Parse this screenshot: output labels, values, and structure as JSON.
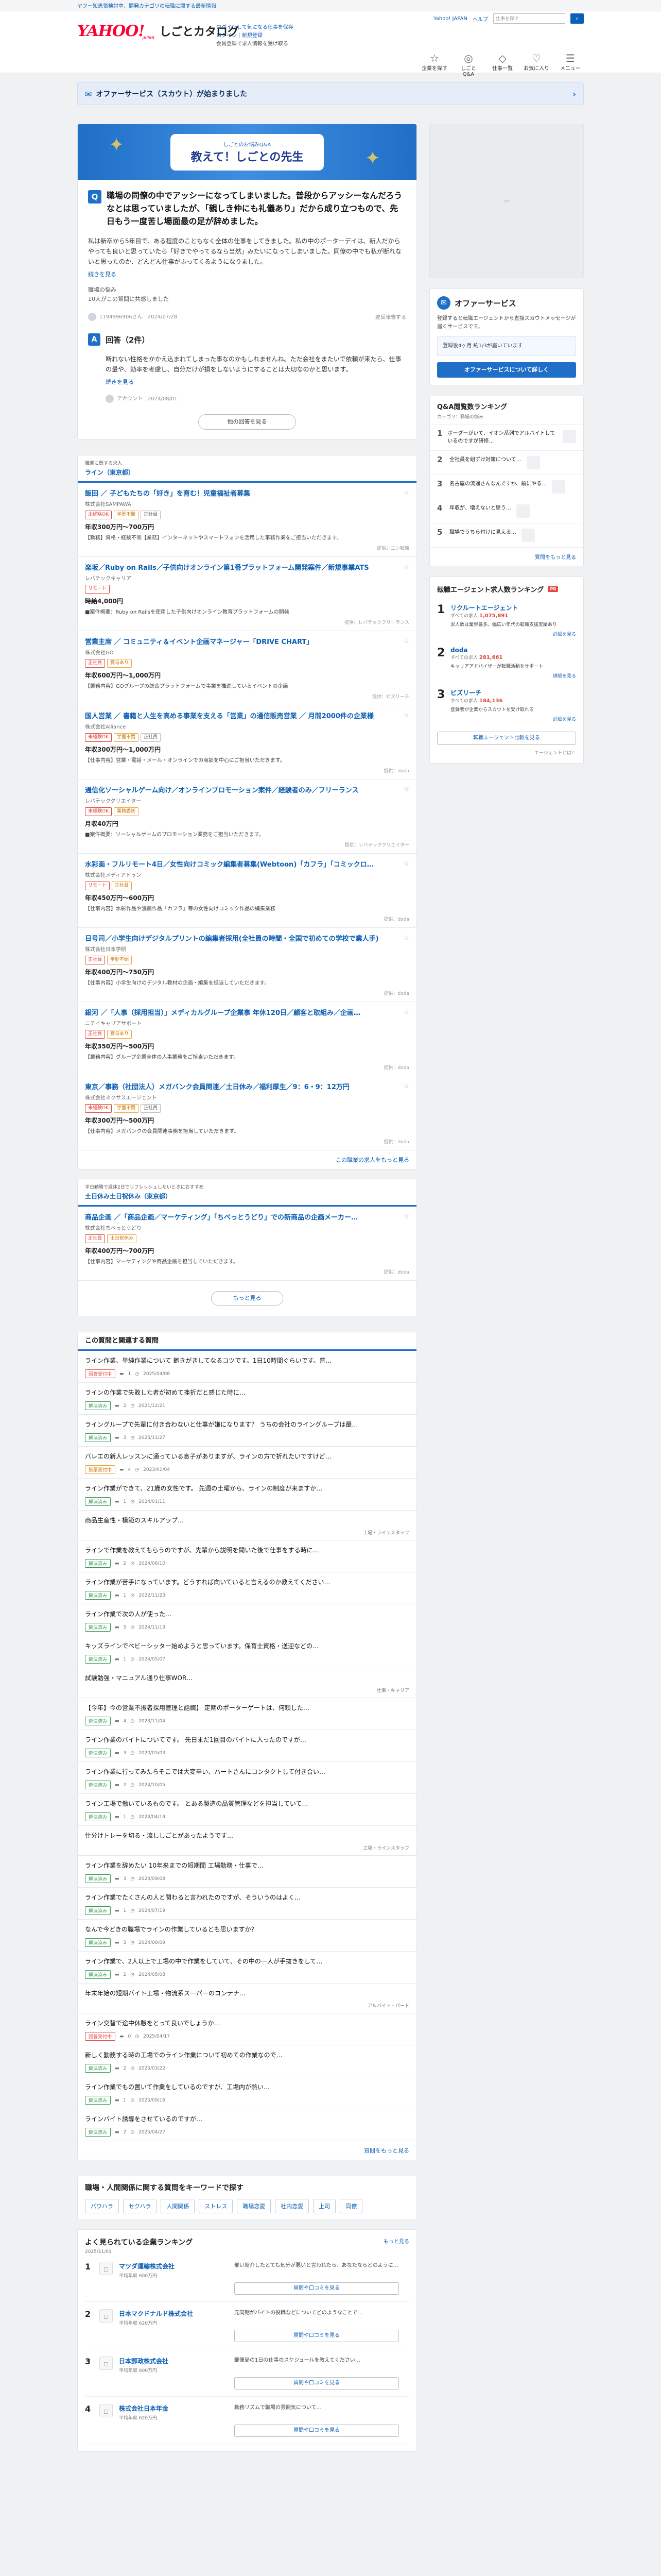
{
  "topstrip": "ヤフー知恵袋検討中、開発カテゴリの転職に関する最新情報",
  "header": {
    "logo_y": "YAHOO!",
    "logo_jp": "JAPAN",
    "title": "しごとカタログ",
    "link1": "ログインして気になる仕事を保存",
    "link2": "ログイン｜新規登録",
    "link3": "会員登録で求人情報を受け取る",
    "tr_yahoo": "Yahoo! JAPAN",
    "tr_help": "ヘルプ",
    "search_ph": "仕事を探す",
    "nav": [
      {
        "icon": "☆",
        "label": "企業を探す"
      },
      {
        "icon": "◎",
        "label": "しごとQ&A"
      },
      {
        "icon": "◇",
        "label": "仕事一覧"
      },
      {
        "icon": "♡",
        "label": "お気に入り"
      },
      {
        "icon": "☰",
        "label": "メニュー"
      }
    ]
  },
  "banner": {
    "text": "オファーサービス（スカウト）が始まりました"
  },
  "question": {
    "hero_small": "しごとのお悩みQ&A",
    "hero_big": "教えて！しごとの先生",
    "mark": "Q",
    "title": "職場の同僚の中でアッシーになってしまいました。普段からアッシーなんだろうなとは思っていましたが、「親しき仲にも礼儀あり」だから成り立つもので、先日もう一度苦し場面最の足が辞めました。",
    "body": "私は新卒から5年目で、ある程度のこともなく全体の仕事をしてきました。私の中のポーターデイは、新人だからやっても良いと思っていたら「好きでやってるなら当然」みたいになってしまいました。同僚の中でも私が断れないと思ったのか、どんどん仕事がふってくるようになりました。",
    "more": "続きを見る",
    "tag_head": "職場の悩み",
    "tags": "10人がこの質問に共感しました",
    "user": "1194996906さん",
    "date": "2024/07/28",
    "report": "違反報告する"
  },
  "answers": {
    "mark": "A",
    "head": "回答（2件）",
    "body": "断れない性格をかかえ込まれてしまった事なのかもしれませんね。ただ会社をまたいで依頼が来たら、仕事の量や、効率を考慮し、自分だけが損をしないようにすることは大切なのかと思います。",
    "more": "続きを見る",
    "user": "アカウント",
    "date": "2024/08/01",
    "all": "他の回答を見る"
  },
  "jobs": {
    "pre": "職業に関する求人",
    "title": "ライン（東京都）",
    "list": [
      {
        "title": "飯田 ／ 子どもたちの「好き」を育む！児童福祉者募集",
        "company": "株式会社SAMPAWA",
        "badges": [
          "未経験OK",
          "学歴不問",
          "正社員"
        ],
        "salary": "年収300万円〜700万円",
        "desc": "【勤務】資格・経験不問【業務】インターネットやスマートフォンを活用した事務作業をご担当いただきます。",
        "src": "提供：エン転職"
      },
      {
        "title": "楽坂／Ruby on Rails／子供向けオンライン第1番プラットフォーム開発案件／新規事業ATS",
        "company": "レバテックキャリア",
        "badges": [
          "リモート"
        ],
        "salary": "時給4,000円",
        "desc": "■案件概要：Ruby on Railsを使用した子供向けオンライン教育プラットフォームの開発",
        "src": "提供：レバテックフリーランス"
      },
      {
        "title": "営業主席 ／ コミュニティ＆イベント企画マネージャー「DRIVE CHART」",
        "company": "株式会社GO",
        "badges": [
          "正社員",
          "賞与あり"
        ],
        "salary": "年収600万円〜1,000万円",
        "desc": "【業務内容】GOグループの総合プラットフォームで事業を推進しているイベントの企画",
        "src": "提供：ビズリーチ"
      },
      {
        "title": "国人営業 ／ 書籍と人生を高める事業を支える「営業」の通信販売営業 ／ 月間2000件の企業様",
        "company": "株式会社Alliance",
        "badges": [
          "未経験OK",
          "学歴不問",
          "正社員"
        ],
        "salary": "年収300万円〜1,000万円",
        "desc": "【仕事内容】営業・電話・メール・オンラインでの商談を中心にご担当いただきます。",
        "src": "提供：doda"
      },
      {
        "title": "通信化ソーシャルゲーム向け／オンラインプロモーション案件／経験者のみ／フリーランス",
        "company": "レバテッククリエイター",
        "badges": [
          "未経験OK",
          "業務委託"
        ],
        "salary": "月収40万円",
        "desc": "■案件概要：ソーシャルゲームのプロモーション業務をご担当いただきます。",
        "src": "提供：レバテッククリエイター"
      },
      {
        "title": "水彩画・フルリモート4日／女性向けコミック編集者募集(Webtoon)「カフラ」「コミックロ…",
        "company": "株式会社メディアトゥン",
        "badges": [
          "リモート",
          "正社員"
        ],
        "salary": "年収450万円〜600万円",
        "desc": "【仕事内容】水彩作品や漫画作品「カフラ」等の女性向けコミック作品の編集業務",
        "src": "提供：doda"
      },
      {
        "title": "日号司／小学生向けデジタルプリントの編集者採用(全社員の時間・全国で初めての学校で業人手)",
        "company": "株式会社日本学研",
        "badges": [
          "正社員",
          "学歴不問"
        ],
        "salary": "年収400万円〜750万円",
        "desc": "【仕事内容】小学生向けのデジタル教材の企画・編集を担当していただきます。",
        "src": "提供：doda"
      },
      {
        "title": "銀河 ／「人事（採用担当）」メディカルグループ企業事 年休120日／顧客と取組み／企画…",
        "company": "ニチイキャリアサポート",
        "badges": [
          "正社員",
          "賞与あり"
        ],
        "salary": "年収350万円〜500万円",
        "desc": "【業務内容】グループ企業全体の人事業務をご担当いただきます。",
        "src": "提供：doda"
      },
      {
        "title": "東京／事務（社団法人）メガバンク会員関連／土日休み／福利厚生／9：6・9：12万円",
        "company": "株式会社ネクサスエージェント",
        "badges": [
          "未経験OK",
          "学歴不問",
          "正社員"
        ],
        "salary": "年収300万円〜500万円",
        "desc": "【仕事内容】メガバンクの会員関連事務を担当していただきます。",
        "src": "提供：doda"
      }
    ],
    "more": "この職業の求人をもっと見る"
  },
  "jobs2": {
    "pre": "平日勤務で週休2日でリフレッシュしたいときにおすすめ",
    "title": "土日休み土日祝休み（東京都）",
    "list": [
      {
        "title": "商品企画 ／「商品企画／マーケティング」「ちベっとうどり」での新商品の企画メーカー…",
        "company": "株式会社ちベっとうどり",
        "badges": [
          "正社員",
          "土日祝休み"
        ],
        "salary": "年収400万円〜700万円",
        "desc": "【仕事内容】マーケティングや商品企画を担当していただきます。",
        "src": "提供：doda"
      }
    ],
    "more": "もっと見る"
  },
  "related": {
    "title": "この質問と関連する質問",
    "list": [
      {
        "t": "ライン作業、単純作業について 飽きがきしてなるコツです。1日10時間ぐらいです。普…",
        "s": "回答受付中",
        "a": "1",
        "d": "2025/04/08",
        "c": ""
      },
      {
        "t": "ラインの作業で失敗した者が初めて挫折だと感じた時に…",
        "s": "解決済み",
        "a": "2",
        "d": "2021/12/21",
        "c": ""
      },
      {
        "t": "ライングループで先輩に付き合わないと仕事が嫌になります？ うちの会社のライングループは最…",
        "s": "解決済み",
        "a": "3",
        "d": "2025/11/27",
        "c": ""
      },
      {
        "t": "バレエの新人レッスンに通っている息子がありますが、ラインの方で折れたいですけど…",
        "s": "投票受付中",
        "a": "4",
        "d": "2023/01/04",
        "c": ""
      },
      {
        "t": "ライン作業ができて、21歳の女性です。 先週の土曜から、ラインの制度が来ますか…",
        "s": "解決済み",
        "a": "1",
        "d": "2024/01/11",
        "c": ""
      },
      {
        "t": "商品生産性・模範のスキルアップ…",
        "s": "",
        "a": "",
        "d": "",
        "c": "工場・ラインスタッフ"
      },
      {
        "t": "ラインで作業を教えてもらうのですが、先輩から説明を聞いた後で仕事をする時に…",
        "s": "解決済み",
        "a": "2",
        "d": "2024/06/10",
        "c": ""
      },
      {
        "t": "ライン作業が苦手になっています。どうすれば向いていると言えるのか教えてください…",
        "s": "解決済み",
        "a": "1",
        "d": "2022/11/23",
        "c": ""
      },
      {
        "t": "ライン作業で次の人が使った…",
        "s": "解決済み",
        "a": "5",
        "d": "2024/11/13",
        "c": ""
      },
      {
        "t": "キッズラインでベビーシッター始めようと思っています。保育士資格・送迎などの…",
        "s": "解決済み",
        "a": "1",
        "d": "2024/05/07",
        "c": ""
      },
      {
        "t": "試験勉強・マニュアル通り仕事WOR…",
        "s": "",
        "a": "",
        "d": "",
        "c": "仕事・キャリア"
      },
      {
        "t": "【今年】今の営業不振者採用管理と話職】 定期のポーターゲートは、何頼した…",
        "s": "解決済み",
        "a": "4",
        "d": "2023/11/04",
        "c": ""
      },
      {
        "t": "ライン作業のバイトについてです。 先日まだ1回目のバイトに入ったのですが…",
        "s": "解決済み",
        "a": "3",
        "d": "2020/05/03",
        "c": ""
      },
      {
        "t": "ライン作業に行ってみたらそこでは大変辛い、ハートさんにコンタクトして付き合い…",
        "s": "解決済み",
        "a": "2",
        "d": "2024/10/05",
        "c": ""
      },
      {
        "t": "ライン工場で働いているものです。 とある製造の品質管理などを担当していて…",
        "s": "解決済み",
        "a": "1",
        "d": "2024/04/19",
        "c": ""
      },
      {
        "t": "仕分けトレーを切る・流ししごとがあったようです…",
        "s": "",
        "a": "",
        "d": "",
        "c": "工場・ラインスタッフ"
      },
      {
        "t": "ライン作業を辞めたい 10年来までの短期間 工場勤務・仕事で…",
        "s": "解決済み",
        "a": "3",
        "d": "2024/09/08",
        "c": ""
      },
      {
        "t": "ライン作業でたくさんの人と関わると言われたのですが、そういうのはよく…",
        "s": "解決済み",
        "a": "1",
        "d": "2024/07/19",
        "c": ""
      },
      {
        "t": "なんで今どきの職場でラインの作業しているとも思いますか？",
        "s": "解決済み",
        "a": "3",
        "d": "2024/08/09",
        "c": ""
      },
      {
        "t": "ライン作業で、2人以上で工場の中で作業をしていて、その中の一人が手抜きをして…",
        "s": "解決済み",
        "a": "2",
        "d": "2024/05/08",
        "c": ""
      },
      {
        "t": "年末年始の短期バイト工場・物流系スーパーのコンテナ…",
        "s": "",
        "a": "",
        "d": "",
        "c": "アルバイト・パート"
      },
      {
        "t": "ライン交替で途中休憩をとって良いでしょうか…",
        "s": "回答受付中",
        "a": "0",
        "d": "2025/04/17",
        "c": ""
      },
      {
        "t": "新しく勤務する時の工場でのライン作業について初めての作業なので…",
        "s": "解決済み",
        "a": "2",
        "d": "2025/03/22",
        "c": ""
      },
      {
        "t": "ライン作業でもの置いて作業をしているのですが、工場内が熱い…",
        "s": "解決済み",
        "a": "1",
        "d": "2025/09/16",
        "c": ""
      },
      {
        "t": "ラインバイト誘導をさせているのですが…",
        "s": "解決済み",
        "a": "2",
        "d": "2025/04/27",
        "c": ""
      }
    ],
    "more": "質問をもっと見る"
  },
  "keywords": {
    "title": "職場・人間関係に関する質問をキーワードで探す",
    "list": [
      "パワハラ",
      "セクハラ",
      "人間関係",
      "ストレス",
      "職場恋愛",
      "社内恋愛",
      "上司",
      "同僚"
    ]
  },
  "company_rank": {
    "title": "よく見られている企業ランキング",
    "more": "もっと見る",
    "date": "2025/11/01",
    "list": [
      {
        "n": "1",
        "name": "マツダ運輸株式会社",
        "score": "平均年収 600万円",
        "q": "部い紹介したとても気分が悪いと言われたら、あなたならどのように…",
        "btn": "質問や口コミを見る"
      },
      {
        "n": "2",
        "name": "日本マクドナルド株式会社",
        "score": "平均年収 620万円",
        "q": "元同期がバイトの役職などについてどのようなことで…",
        "btn": "質問や口コミを見る"
      },
      {
        "n": "3",
        "name": "日本郵政株式会社",
        "score": "平均年収 600万円",
        "q": "郵便局の1日の仕事のスケジュールを教えてください…",
        "btn": "質問や口コミを見る"
      },
      {
        "n": "4",
        "name": "株式会社日本年金",
        "score": "平均年収 620万円",
        "q": "勤務リズムで職場の雰囲気について…",
        "btn": "質問や口コミを見る"
      }
    ]
  },
  "offer": {
    "title": "オファーサービス",
    "p": "登録すると転職エージェントから直接スカウトメッセージが届くサービスです。",
    "box": "登録後4ヶ月 約1/3が届いています",
    "btn": "オファーサービスについて詳しく"
  },
  "side_rank": {
    "title": "Q&A閲覧数ランキング",
    "sub": "カテゴリ：職場の悩み",
    "list": [
      "ボーダーがいて、イオン系列でアルバイトしているのですが研修…",
      "全社員を組ずけ対策について…",
      "名古屋の流通さんなんですか、前にやる…",
      "年収が、増えないと思う…",
      "職場でうちら付けに見える…"
    ],
    "more": "質問をもっと見る"
  },
  "agent_rank": {
    "title": "転職エージェント求人数ランキング",
    "tag": "PR",
    "list": [
      {
        "n": "1",
        "name": "リクルートエージェント",
        "rc": "すべての求人",
        "num": "1,075,891",
        "ds": "求人数は業界最多。幅広い年代の転職支援実績あり",
        "lm": "詳細を見る"
      },
      {
        "n": "2",
        "name": "doda",
        "rc": "すべての求人",
        "num": "281,661",
        "ds": "キャリアアドバイザーが転職活動をサポート",
        "lm": "詳細を見る"
      },
      {
        "n": "3",
        "name": "ビズリーチ",
        "rc": "すべての求人",
        "num": "184,136",
        "ds": "登録者が企業からスカウトを受け取れる",
        "lm": "詳細を見る"
      }
    ],
    "btn": "転職エージェント比較を見る",
    "foot": "エージェントとは？"
  }
}
